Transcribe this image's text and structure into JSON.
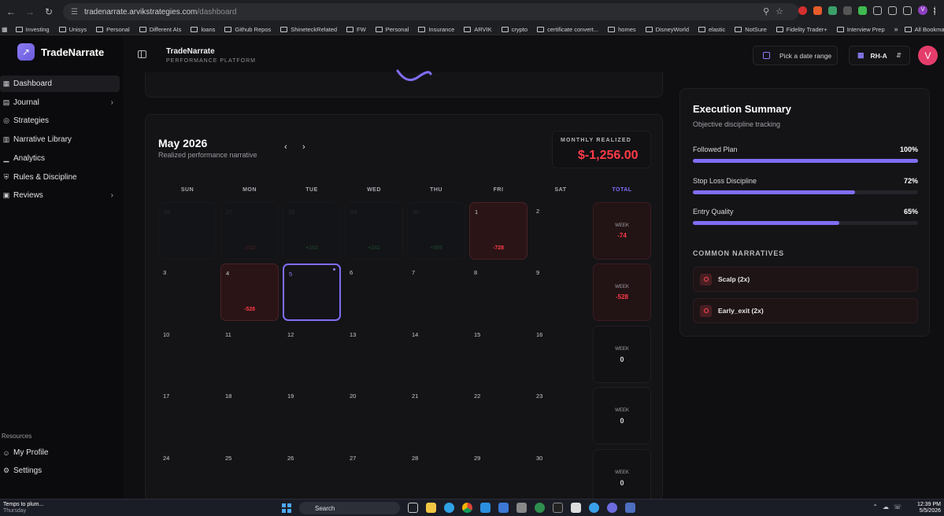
{
  "browser": {
    "url_host": "tradenarrate.arvikstrategies.com",
    "url_path": "/dashboard",
    "bookmarks": [
      "Investing",
      "Unisys",
      "Personal",
      "Different AIs",
      "loans",
      "Github Repos",
      "ShineteckRelated",
      "FW",
      "Personal",
      "Insurance",
      "ARVIK",
      "crypto",
      "certificate convert...",
      "homes",
      "DisneyWorld",
      "elastic",
      "NotSure",
      "Fidelity Trader+",
      "Interview Prep"
    ],
    "all_bookmarks": "All Bookmarks",
    "profile_initial": "V"
  },
  "sidebar": {
    "brand": "TradeNarrate",
    "items": [
      {
        "label": "Dashboard",
        "icon": "grid-icon",
        "active": true
      },
      {
        "label": "Journal",
        "icon": "book-icon",
        "chevron": true
      },
      {
        "label": "Strategies",
        "icon": "target-icon"
      },
      {
        "label": "Narrative Library",
        "icon": "file-icon"
      },
      {
        "label": "Analytics",
        "icon": "bar-chart-icon"
      },
      {
        "label": "Rules & Discipline",
        "icon": "shield-icon"
      },
      {
        "label": "Reviews",
        "icon": "calendar-icon",
        "chevron": true
      }
    ],
    "resources_label": "Resources",
    "resources": [
      {
        "label": "My Profile",
        "icon": "user-icon"
      },
      {
        "label": "Settings",
        "icon": "gear-icon"
      }
    ]
  },
  "topbar": {
    "title": "TradeNarrate",
    "subtitle": "PERFORMANCE PLATFORM",
    "date_range": "Pick a date range",
    "account": "RH-A",
    "avatar": "V"
  },
  "calendar": {
    "month": "May 2026",
    "subtitle": "Realized performance narrative",
    "monthly_label": "MONTHLY REALIZED",
    "monthly_value": "$-1,256.00",
    "days_of_week": [
      "SUN",
      "MON",
      "TUE",
      "WED",
      "THU",
      "FRI",
      "SAT",
      "TOTAL"
    ],
    "week_label": "WEEK",
    "weeks": [
      {
        "days": [
          {
            "n": "26",
            "faint": true
          },
          {
            "n": "27",
            "faint": true,
            "pnl": "-312",
            "tone": "neg"
          },
          {
            "n": "28",
            "faint": true,
            "pnl": "+102",
            "tone": "pos"
          },
          {
            "n": "29",
            "faint": true,
            "pnl": "+241",
            "tone": "pos"
          },
          {
            "n": "30",
            "faint": true,
            "pnl": "+305",
            "tone": "pos"
          },
          {
            "n": "1",
            "pnl": "-728",
            "tone": "loss"
          },
          {
            "n": "2"
          }
        ],
        "total": "-74",
        "neg": true
      },
      {
        "days": [
          {
            "n": "3"
          },
          {
            "n": "4",
            "pnl": "-528",
            "tone": "loss"
          },
          {
            "n": "5",
            "selected": true
          },
          {
            "n": "6"
          },
          {
            "n": "7"
          },
          {
            "n": "8"
          },
          {
            "n": "9"
          }
        ],
        "total": "-528",
        "neg": true
      },
      {
        "days": [
          {
            "n": "10"
          },
          {
            "n": "11"
          },
          {
            "n": "12"
          },
          {
            "n": "13"
          },
          {
            "n": "14"
          },
          {
            "n": "15"
          },
          {
            "n": "16"
          }
        ],
        "total": "0"
      },
      {
        "days": [
          {
            "n": "17"
          },
          {
            "n": "18"
          },
          {
            "n": "19"
          },
          {
            "n": "20"
          },
          {
            "n": "21"
          },
          {
            "n": "22"
          },
          {
            "n": "23"
          }
        ],
        "total": "0"
      },
      {
        "days": [
          {
            "n": "24"
          },
          {
            "n": "25"
          },
          {
            "n": "26"
          },
          {
            "n": "27"
          },
          {
            "n": "28"
          },
          {
            "n": "29"
          },
          {
            "n": "30"
          }
        ],
        "total": "0"
      }
    ]
  },
  "summary": {
    "title": "Execution Summary",
    "subtitle": "Objective discipline tracking",
    "metrics": [
      {
        "label": "Followed Plan",
        "value": "100%",
        "pct": 100
      },
      {
        "label": "Stop Loss Discipline",
        "value": "72%",
        "pct": 72
      },
      {
        "label": "Entry Quality",
        "value": "65%",
        "pct": 65
      }
    ],
    "narratives_label": "COMMON NARRATIVES",
    "narratives": [
      "Scalp (2x)",
      "Early_exit (2x)"
    ]
  },
  "taskbar": {
    "weather_line1": "Temps to plum...",
    "weather_line2": "Thursday",
    "search": "Search",
    "time": "12:39 PM",
    "date": "5/5/2026"
  },
  "colors": {
    "accent": "#7f6ef5",
    "loss": "#ff3b47",
    "avatar": "#e43d6b"
  }
}
